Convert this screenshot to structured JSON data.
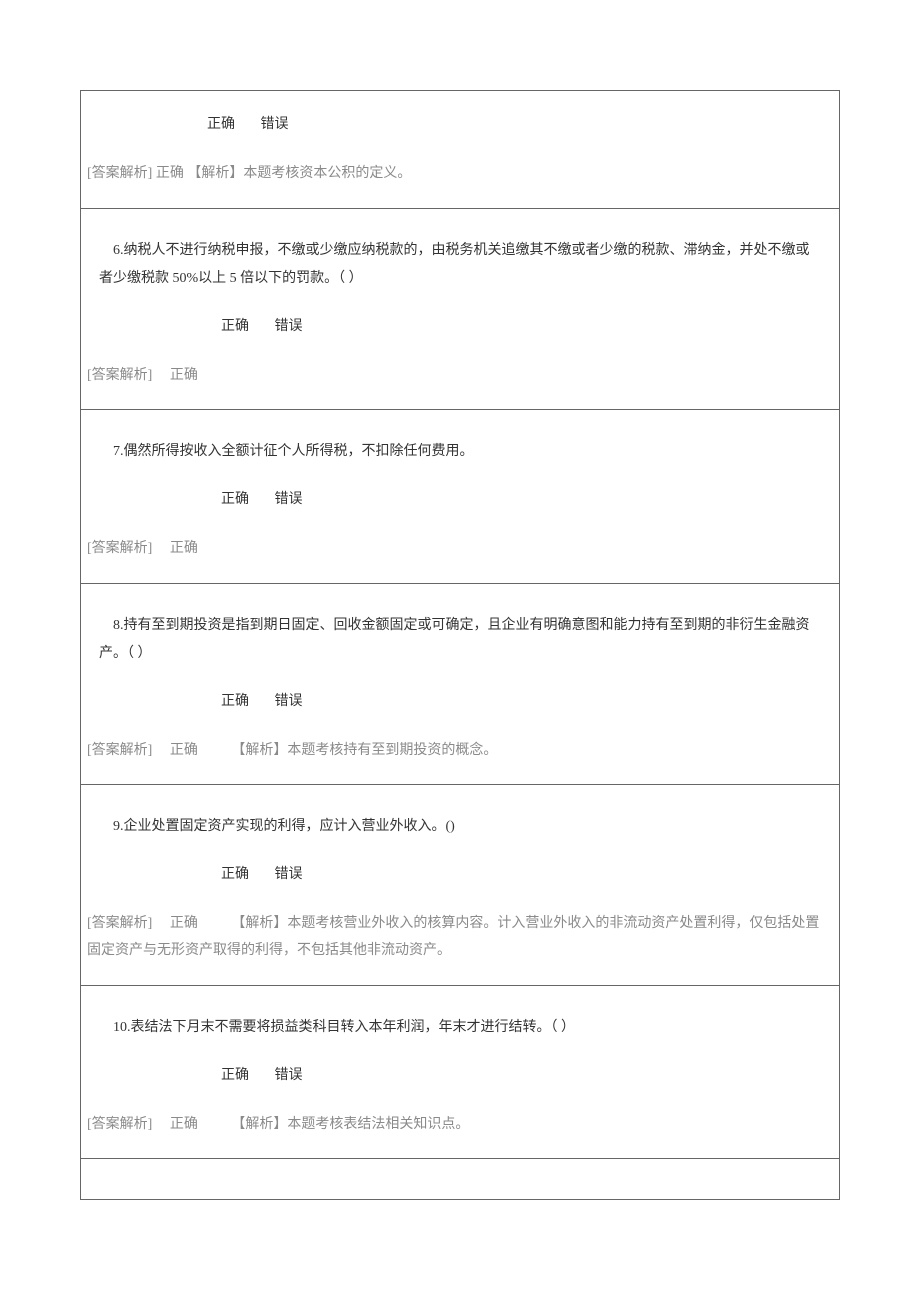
{
  "options": {
    "correct": "正确",
    "wrong": "错误"
  },
  "answer_label": "[答案解析]",
  "top": {
    "answer_value": "正确",
    "explanation": "【解析】本题考核资本公积的定义。"
  },
  "q6": {
    "text": "6.纳税人不进行纳税申报，不缴或少缴应纳税款的，由税务机关追缴其不缴或者少缴的税款、滞纳金，并处不缴或者少缴税款 50%以上 5 倍以下的罚款。（ ）",
    "answer_value": "正确",
    "explanation": ""
  },
  "q7": {
    "text": "7.偶然所得按收入全额计征个人所得税，不扣除任何费用。",
    "answer_value": "正确",
    "explanation": ""
  },
  "q8": {
    "text": "8.持有至到期投资是指到期日固定、回收金额固定或可确定，且企业有明确意图和能力持有至到期的非衍生金融资产。（ ）",
    "answer_value": "正确",
    "explanation": "【解析】本题考核持有至到期投资的概念。"
  },
  "q9": {
    "text": "9.企业处置固定资产实现的利得，应计入营业外收入。()",
    "answer_value": "正确",
    "explanation": "【解析】本题考核营业外收入的核算内容。计入营业外收入的非流动资产处置利得，仅包括处置固定资产与无形资产取得的利得，不包括其他非流动资产。"
  },
  "q10": {
    "text": "10.表结法下月末不需要将损益类科目转入本年利润，年末才进行结转。（ ）",
    "answer_value": "正确",
    "explanation": "【解析】本题考核表结法相关知识点。"
  }
}
